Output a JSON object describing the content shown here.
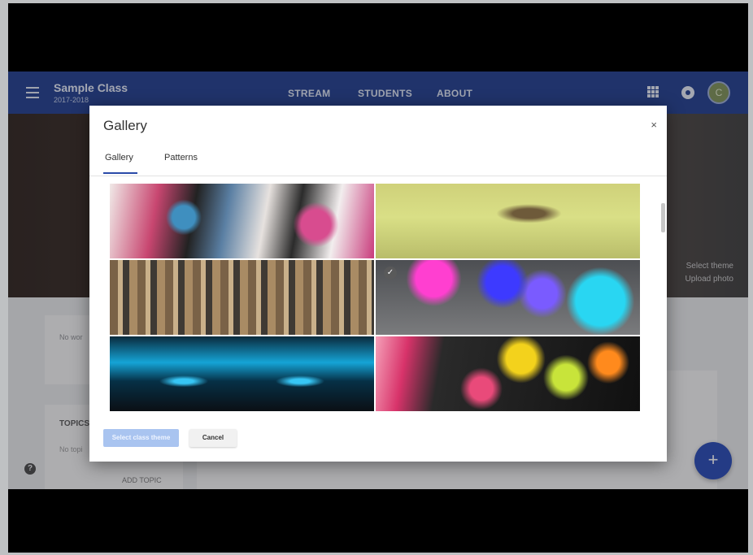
{
  "header": {
    "class_name": "Sample Class",
    "class_year": "2017-2018",
    "nav": [
      "STREAM",
      "STUDENTS",
      "ABOUT"
    ],
    "avatar_initial": "C"
  },
  "banner": {
    "select_theme": "Select theme",
    "upload_photo": "Upload photo"
  },
  "page": {
    "card_text": "No wor",
    "topics_label": "TOPICS",
    "topics_empty": "No topi",
    "add_topic": "ADD TOPIC",
    "fab_label": "+"
  },
  "modal": {
    "title": "Gallery",
    "close_label": "×",
    "tabs": [
      {
        "label": "Gallery",
        "active": true
      },
      {
        "label": "Patterns",
        "active": false
      }
    ],
    "images": [
      {
        "icon": "paint-hands-image"
      },
      {
        "icon": "book-heart-image"
      },
      {
        "icon": "paint-brushes-image"
      },
      {
        "icon": "chemistry-flasks-image",
        "selected": true
      },
      {
        "icon": "blue-lab-equipment-image"
      },
      {
        "icon": "colored-pencils-bokeh-image"
      }
    ],
    "select_button": "Select class theme",
    "cancel_button": "Cancel"
  },
  "colors": {
    "topbar": "#1c3a8c",
    "accent": "#2a4aa8",
    "fab": "#2346b4",
    "primary_button_disabled": "#a9c4f0"
  }
}
